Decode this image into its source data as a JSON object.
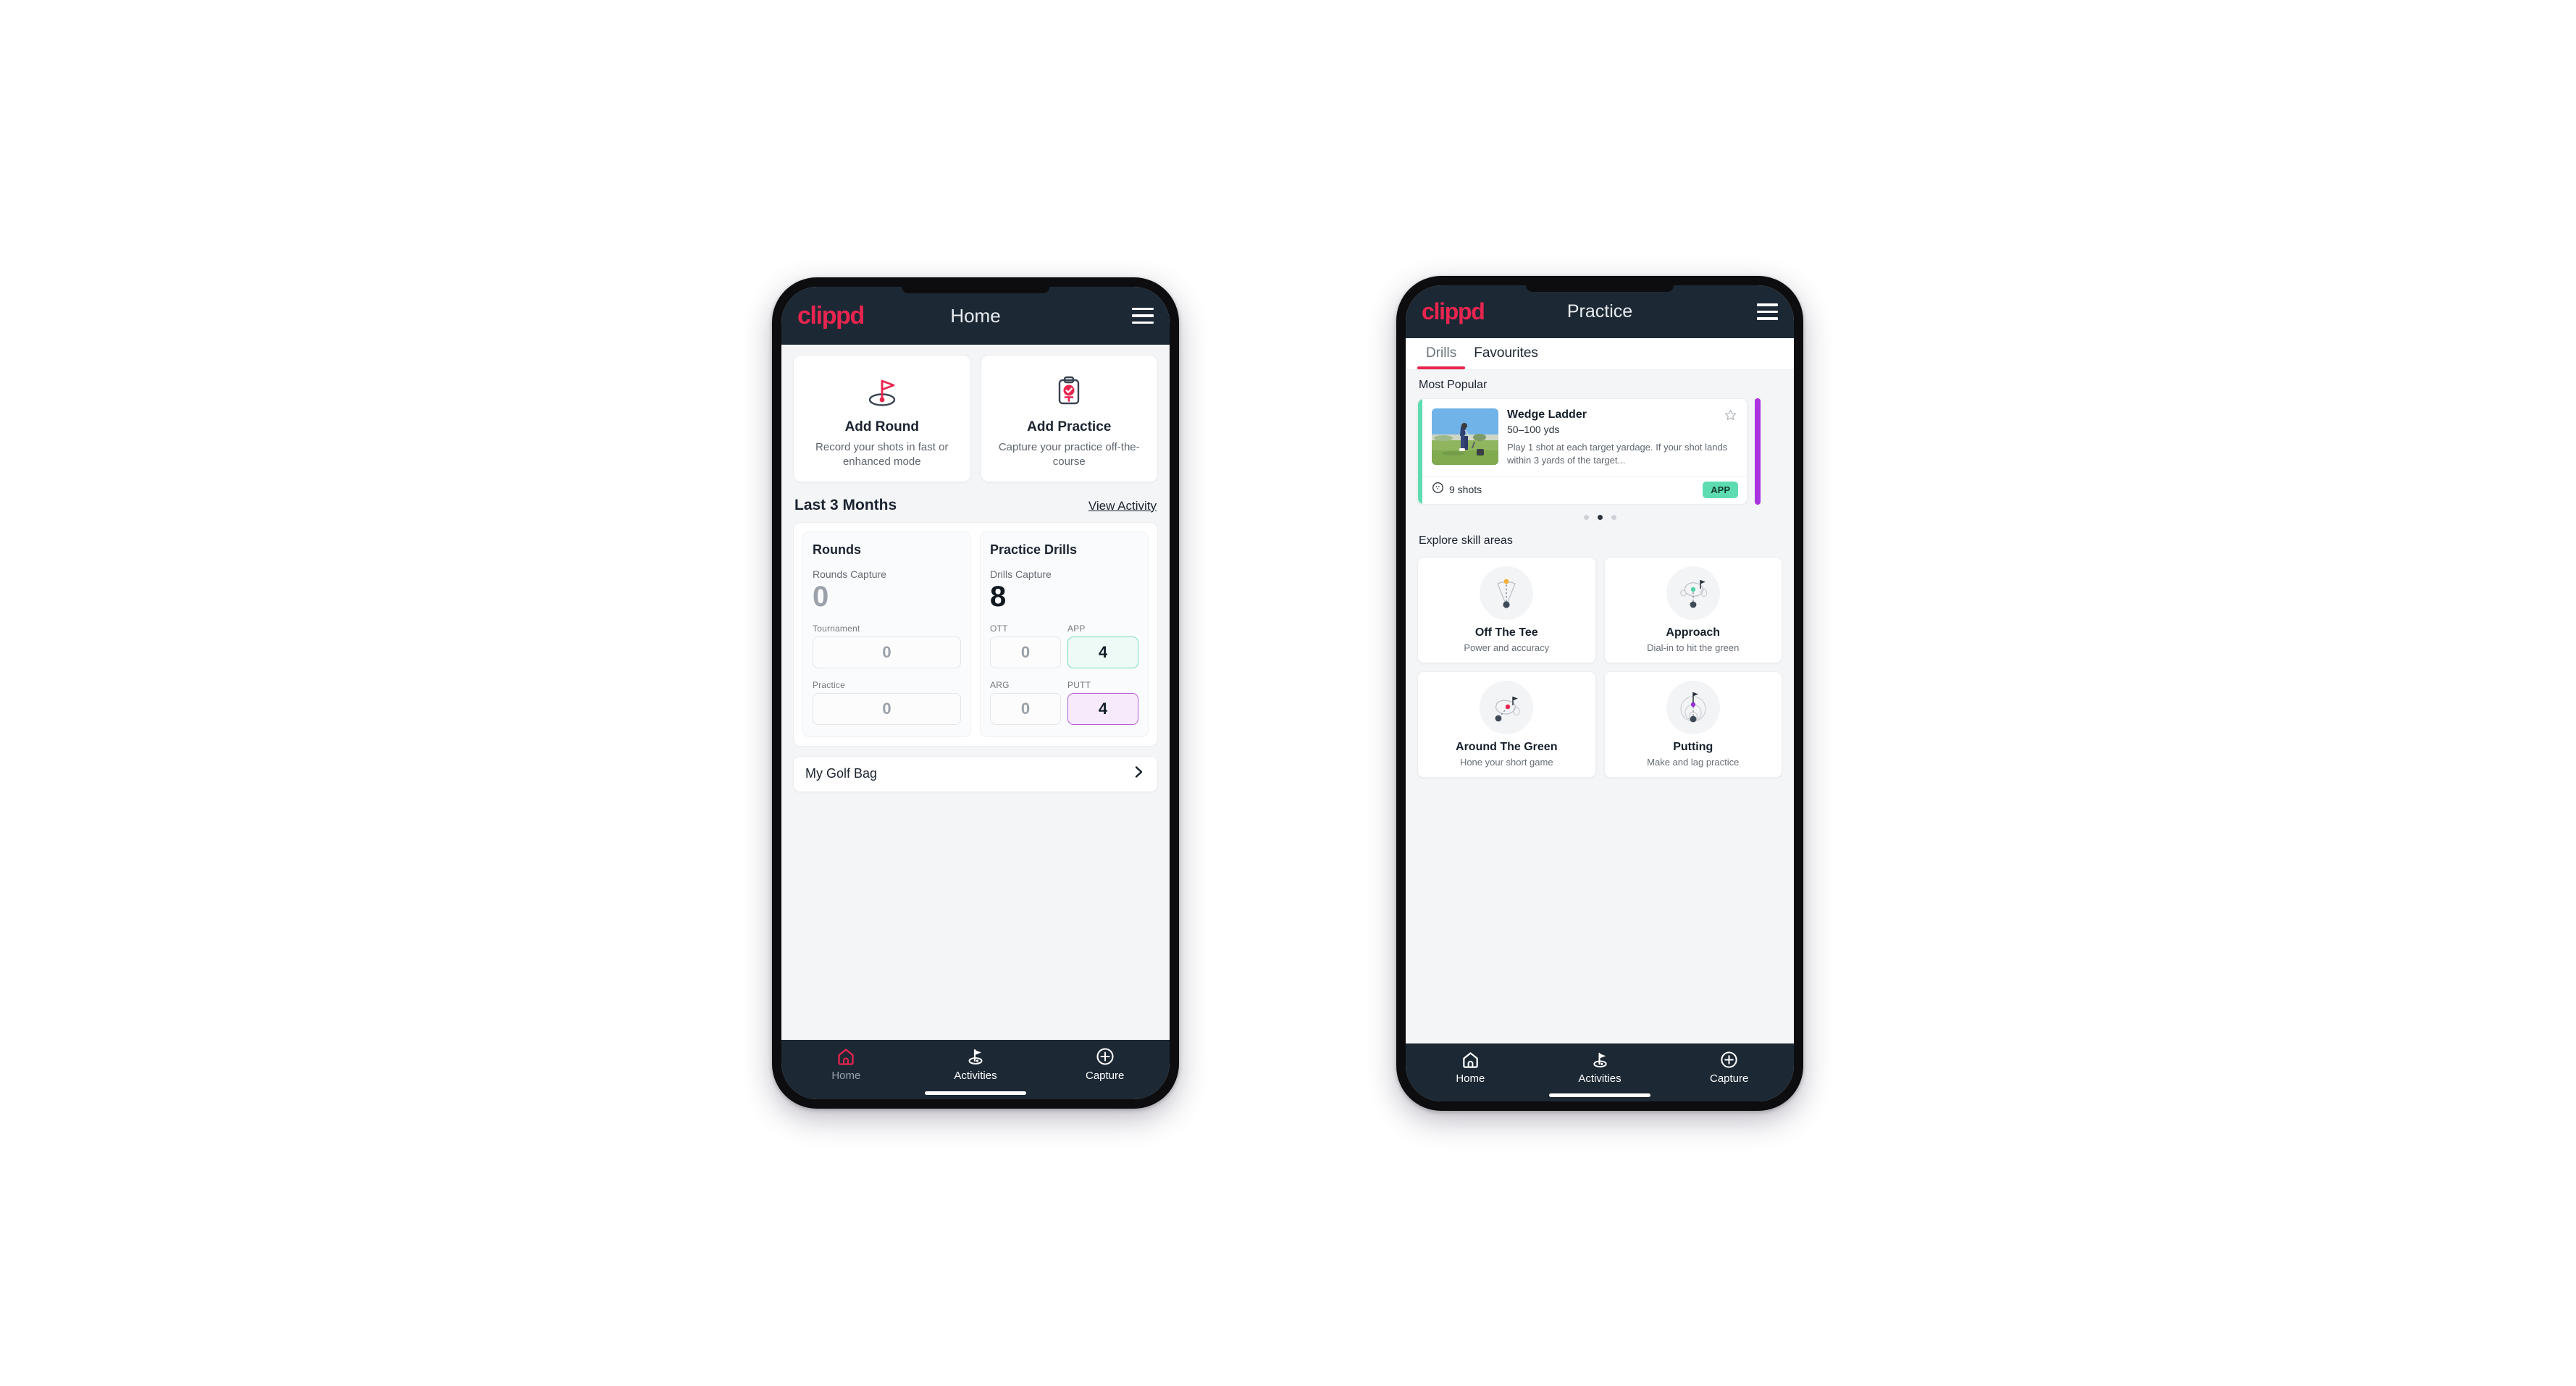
{
  "brand": {
    "name": "clippd",
    "pink": "#e8254f",
    "navy": "#1c2834",
    "mint": "#5ddcb2",
    "purple": "#aa33e0"
  },
  "phone1": {
    "header": {
      "logo": "clippd",
      "title": "Home",
      "menu_icon": "hamburger-icon"
    },
    "quick_actions": [
      {
        "icon": "golf-flag-icon",
        "title": "Add Round",
        "subtitle": "Record your shots in fast or enhanced mode"
      },
      {
        "icon": "clipboard-check-icon",
        "title": "Add Practice",
        "subtitle": "Capture your practice off-the-course"
      }
    ],
    "section": {
      "title": "Last 3 Months",
      "action": "View Activity"
    },
    "rounds": {
      "heading": "Rounds",
      "capture_label": "Rounds Capture",
      "capture_value": "0",
      "fields": [
        {
          "label": "Tournament",
          "value": "0",
          "style": "plain"
        },
        {
          "label": "Practice",
          "value": "0",
          "style": "plain"
        }
      ]
    },
    "drills": {
      "heading": "Practice Drills",
      "capture_label": "Drills Capture",
      "capture_value": "8",
      "fields": [
        {
          "label": "OTT",
          "value": "0",
          "style": "plain"
        },
        {
          "label": "APP",
          "value": "4",
          "style": "app"
        },
        {
          "label": "ARG",
          "value": "0",
          "style": "plain"
        },
        {
          "label": "PUTT",
          "value": "4",
          "style": "putt"
        }
      ]
    },
    "golf_bag": {
      "label": "My Golf Bag",
      "chevron": "chevron-right-icon"
    },
    "bottom_nav": [
      {
        "label": "Home",
        "icon": "home-icon",
        "active": true
      },
      {
        "label": "Activities",
        "icon": "golf-flag-icon",
        "active": false
      },
      {
        "label": "Capture",
        "icon": "plus-circle-icon",
        "active": false
      }
    ]
  },
  "phone2": {
    "header": {
      "logo": "clippd",
      "title": "Practice",
      "menu_icon": "hamburger-icon"
    },
    "tabs": [
      {
        "label": "Drills",
        "selected": true
      },
      {
        "label": "Favourites",
        "selected": false
      }
    ],
    "most_popular_label": "Most Popular",
    "drill": {
      "name": "Wedge Ladder",
      "yardage": "50–100 yds",
      "description": "Play 1 shot at each target yardage. If your shot lands within 3 yards of the target...",
      "shots": "9 shots",
      "shots_icon": "golf-ball-icon",
      "badge": "APP",
      "star_icon": "star-outline-icon",
      "thumb_icon": "golfer-photo"
    },
    "carousel_dots": {
      "count": 3,
      "active_index": 1
    },
    "explore_label": "Explore skill areas",
    "skills": [
      {
        "title": "Off The Tee",
        "subtitle": "Power and accuracy",
        "icon": "tee-shot-dispersion-icon",
        "dot": "#f2b134"
      },
      {
        "title": "Approach",
        "subtitle": "Dial-in to hit the green",
        "icon": "approach-green-icon",
        "dot": "#4fd0a8"
      },
      {
        "title": "Around The Green",
        "subtitle": "Hone your short game",
        "icon": "chip-green-icon",
        "dot": "#e8254f"
      },
      {
        "title": "Putting",
        "subtitle": "Make and lag practice",
        "icon": "putting-rings-icon",
        "dot": "#9b30d9"
      }
    ],
    "bottom_nav": [
      {
        "label": "Home",
        "icon": "home-icon",
        "active": false
      },
      {
        "label": "Activities",
        "icon": "golf-flag-icon",
        "active": false
      },
      {
        "label": "Capture",
        "icon": "plus-circle-icon",
        "active": false
      }
    ]
  }
}
